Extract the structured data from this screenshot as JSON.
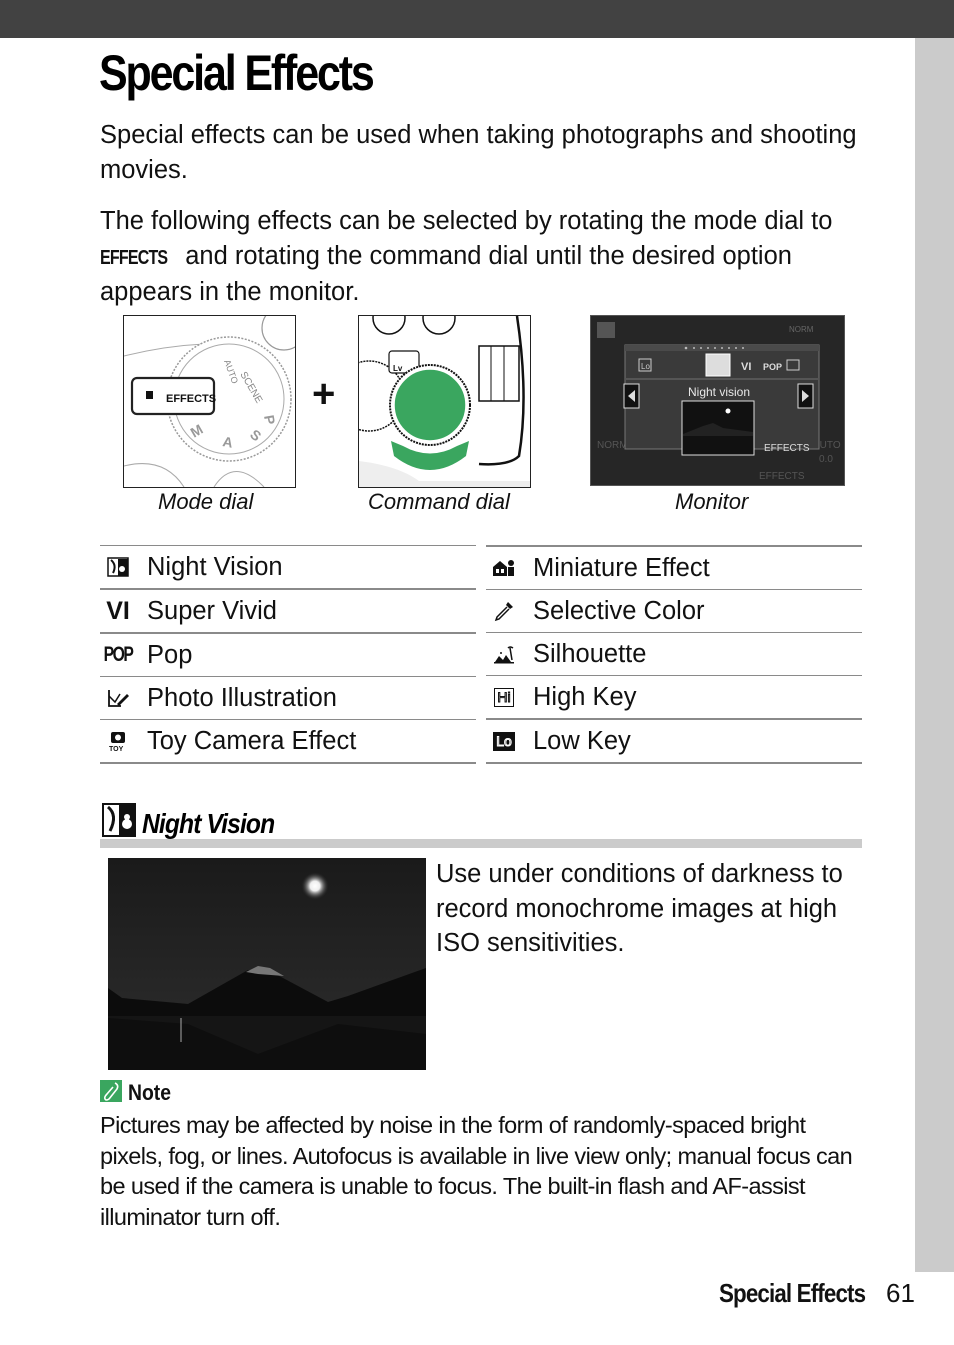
{
  "page": {
    "title": "Special Effects",
    "intro": "Special effects can be used when taking photographs and shooting movies.",
    "instructions": {
      "before": "The following effects can be selected by rotating the mode dial to ",
      "mode_symbol": "EFFECTS",
      "after": " and rotating the command dial until the desired option appears in the monitor."
    }
  },
  "figures": {
    "mode_dial": {
      "caption": "Mode dial",
      "dial_label": "EFFECTS",
      "dial_marks": [
        "AUTO",
        "SCENE",
        "P",
        "S",
        "A",
        "M"
      ]
    },
    "plus_sign": "+",
    "command_dial": {
      "caption": "Command dial",
      "button_label": "Lv",
      "accent_color": "#3aa65f"
    },
    "monitor": {
      "caption": "Monitor",
      "selected_effect": "Night vision",
      "top_icons": [
        "Lo",
        "night-vision",
        "VI",
        "POP",
        "photo-illustration"
      ],
      "mode_label": "EFFECTS",
      "footer_label": "EFFECTS",
      "quality": "NORM",
      "iso": "AUTO",
      "exposure": "0.0"
    }
  },
  "effects": {
    "left": [
      {
        "icon": "night-vision-icon",
        "label": "Night Vision"
      },
      {
        "icon": "super-vivid-icon",
        "glyph": "VI",
        "label": "Super Vivid"
      },
      {
        "icon": "pop-icon",
        "glyph": "POP",
        "label": "Pop"
      },
      {
        "icon": "photo-illustration-icon",
        "label": "Photo Illustration"
      },
      {
        "icon": "toy-camera-icon",
        "glyph": "TOY",
        "label": "Toy Camera Effect"
      }
    ],
    "right": [
      {
        "icon": "miniature-effect-icon",
        "label": "Miniature Effect"
      },
      {
        "icon": "selective-color-icon",
        "label": "Selective Color"
      },
      {
        "icon": "silhouette-icon",
        "label": "Silhouette"
      },
      {
        "icon": "high-key-icon",
        "glyph": "Hi",
        "label": "High Key"
      },
      {
        "icon": "low-key-icon",
        "glyph": "Lo",
        "label": "Low Key"
      }
    ]
  },
  "section": {
    "title": "Night Vision",
    "description": "Use under conditions of darkness to record monochrome images at high ISO sensitivities.",
    "note": {
      "title": "Note",
      "body": "Pictures may be affected by noise in the form of randomly-spaced bright pixels, fog, or lines.  Autofocus is available in live view only; manual focus can be used if the camera is unable to focus.  The built-in flash and AF-assist illuminator turn off.",
      "icon_color": "#3aa65f"
    }
  },
  "footer": {
    "section": "Special Effects",
    "page_number": "61"
  },
  "colors": {
    "top_bar": "#424242",
    "side_tab": "#cbcbcb",
    "rule": "#8a8a8a"
  }
}
